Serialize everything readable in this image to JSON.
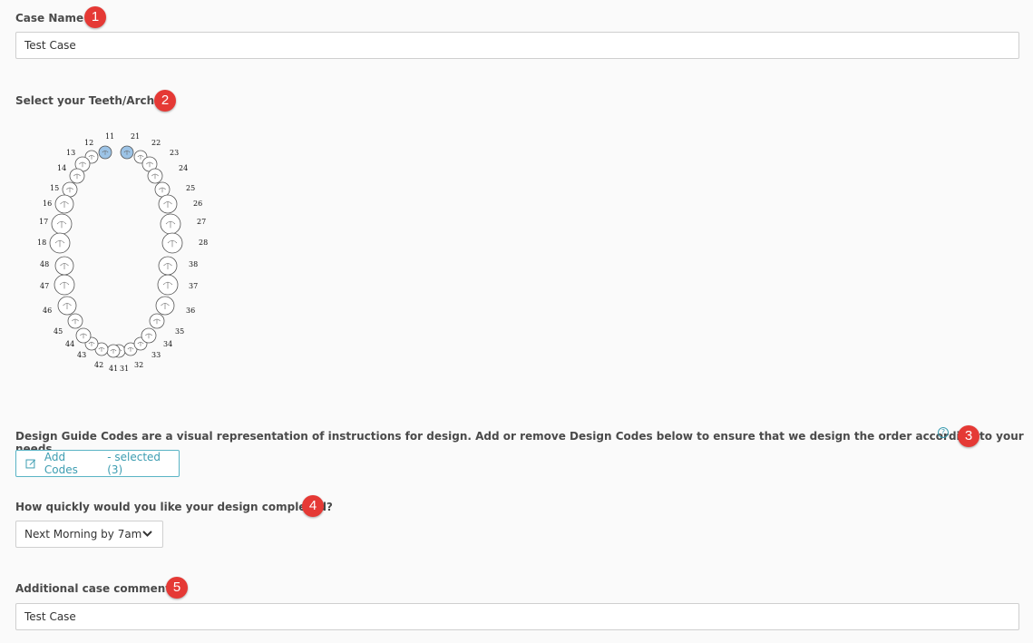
{
  "case_name": {
    "label": "Case Name",
    "badge": "1",
    "value": "Test Case"
  },
  "teeth": {
    "label": "Select your Teeth/Arches",
    "badge": "2",
    "selected": [
      "11",
      "21"
    ],
    "selected_color": "#9cc3e6",
    "upper_right": [
      "11",
      "12",
      "13",
      "14",
      "15",
      "16",
      "17",
      "18"
    ],
    "upper_left": [
      "21",
      "22",
      "23",
      "24",
      "25",
      "26",
      "27",
      "28"
    ],
    "lower_left": [
      "31",
      "32",
      "33",
      "34",
      "35",
      "36",
      "37",
      "38"
    ],
    "lower_right": [
      "41",
      "42",
      "43",
      "44",
      "45",
      "46",
      "47",
      "48"
    ]
  },
  "design_codes": {
    "description": "Design Guide Codes are a visual representation of instructions for design. Add or remove Design Codes below to ensure that we design the order according to your needs.",
    "help_icon": "question-circle-icon",
    "help_glyph": "?",
    "badge": "3",
    "button_label": "Add Codes",
    "selected_text": "- selected (3)",
    "button_icon": "edit-icon",
    "accent": "#3d9db1"
  },
  "turnaround": {
    "label": "How quickly would you like your design completed?",
    "badge": "4",
    "selected": "Next Morning by 7am",
    "icon": "chevron-down-icon"
  },
  "comments": {
    "label": "Additional case comments",
    "badge": "5",
    "value": "Test Case"
  },
  "colors": {
    "badge": "#e53935",
    "border": "#cfcfcf",
    "background": "#fafafa"
  }
}
